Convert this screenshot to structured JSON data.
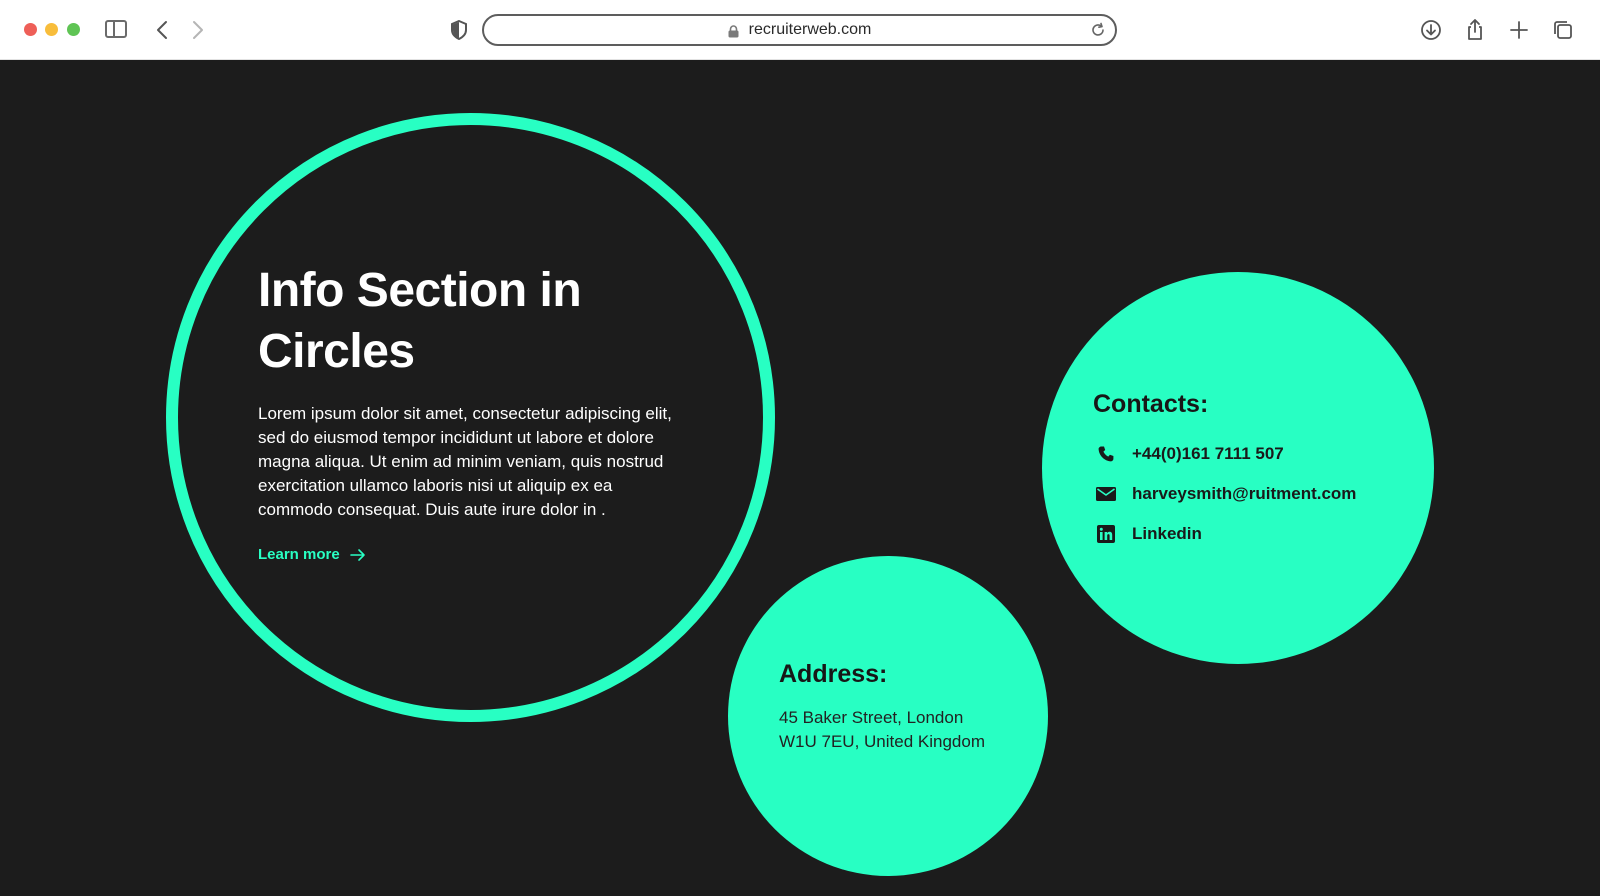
{
  "browser": {
    "url": "recruiterweb.com",
    "accent_colors": {
      "close": "#ee5f58",
      "minimize": "#f8bd3b",
      "maximize": "#5fc454"
    },
    "icons": [
      "sidebar-icon",
      "back-icon",
      "forward-icon",
      "shield-icon",
      "lock-icon",
      "reload-icon",
      "download-icon",
      "share-icon",
      "new-tab-icon",
      "tabs-overview-icon"
    ]
  },
  "theme": {
    "background": "#1c1c1c",
    "accent": "#28ffc3",
    "text_light": "#ffffff",
    "text_dark": "#171717"
  },
  "info": {
    "title": "Info Section in Circles",
    "body": "Lorem ipsum dolor sit amet, consectetur adipiscing elit, sed do eiusmod tempor incididunt ut labore et dolore magna aliqua. Ut enim ad minim veniam, quis nostrud exercitation ullamco laboris nisi ut aliquip ex ea commodo consequat. Duis aute irure dolor in .",
    "link_label": "Learn more"
  },
  "address": {
    "title": "Address:",
    "line1": "45 Baker Street, London",
    "line2": "W1U 7EU, United Kingdom"
  },
  "contacts": {
    "title": "Contacts:",
    "phone": "+44(0)161 7111 507",
    "email": "harveysmith@ruitment.com",
    "linkedin": "Linkedin"
  }
}
